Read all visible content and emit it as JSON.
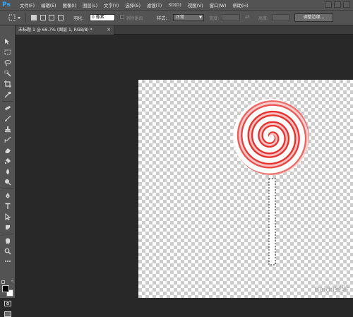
{
  "app": {
    "logo": "Ps"
  },
  "menu": [
    "文件(F)",
    "编辑(E)",
    "图像(I)",
    "图层(L)",
    "文字(Y)",
    "选择(S)",
    "滤镜(T)",
    "3D(D)",
    "视图(V)",
    "窗口(W)",
    "帮助(H)"
  ],
  "options": {
    "feather_label": "羽化:",
    "feather_value": "0 像素",
    "antialias_label": "消除锯齿",
    "style_label": "样式:",
    "style_value": "正常",
    "width_label": "宽度:",
    "height_label": "高度:",
    "refine_edge": "调整边缘..."
  },
  "document": {
    "tab_title": "未标题-1 @ 66.7% (图层 1, RGB/8) *",
    "close_glyph": "×"
  },
  "colors": {
    "lollipop_red": "#e8302c",
    "foreground": "#000000",
    "background": "#ffffff",
    "arrow": "#e0231e",
    "ps_blue": "#31a8ff"
  },
  "tools": [
    "move-tool",
    "marquee-tool",
    "lasso-tool",
    "quick-selection-tool",
    "crop-tool",
    "eyedropper-tool",
    "spot-healing-tool",
    "brush-tool",
    "clone-stamp-tool",
    "history-brush-tool",
    "eraser-tool",
    "gradient-tool",
    "blur-tool",
    "dodge-tool",
    "pen-tool",
    "type-tool",
    "path-selection-tool",
    "shape-tool",
    "hand-tool",
    "zoom-tool"
  ],
  "watermark": "Baidu经验"
}
